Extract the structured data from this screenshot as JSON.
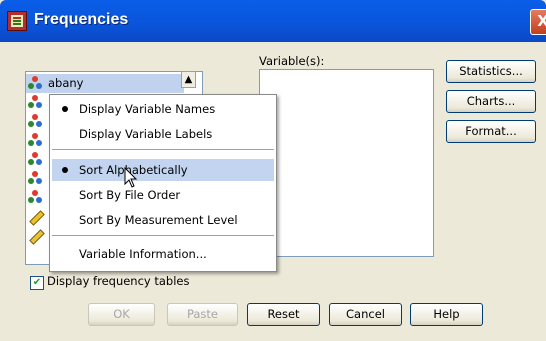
{
  "window": {
    "title": "Frequencies",
    "close_glyph": "X"
  },
  "variable_list": {
    "selected_item": "abany",
    "scroll_up_glyph": "▲",
    "icons": [
      "nominal-icon",
      "nominal-icon",
      "nominal-icon",
      "nominal-icon",
      "nominal-icon",
      "nominal-icon",
      "nominal-icon",
      "scale-icon",
      "scale-icon"
    ]
  },
  "target": {
    "label": "Variable(s):"
  },
  "side_buttons": {
    "statistics": "Statistics...",
    "charts": "Charts...",
    "format": "Format..."
  },
  "context_menu": {
    "items": [
      {
        "label": "Display Variable Names",
        "checked": true
      },
      {
        "label": "Display Variable Labels",
        "checked": false
      },
      {
        "label": "Sort Alphabetically",
        "checked": true,
        "highlighted": true
      },
      {
        "label": "Sort By File Order",
        "checked": false
      },
      {
        "label": "Sort By Measurement Level",
        "checked": false
      },
      {
        "label": "Variable Information...",
        "checked": false
      }
    ]
  },
  "display_tables": {
    "label": "Display frequency tables",
    "checked": true
  },
  "bottom_buttons": {
    "ok": "OK",
    "paste": "Paste",
    "reset": "Reset",
    "cancel": "Cancel",
    "help": "Help"
  },
  "colors": {
    "titlebar": "#0a55dc",
    "dialog": "#ece9d8",
    "menu_highlight": "#c2d4ef"
  }
}
